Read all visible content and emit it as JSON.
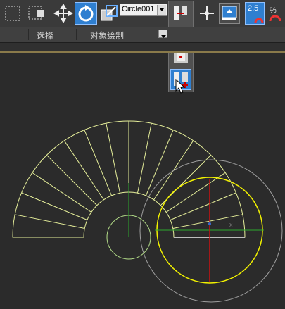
{
  "toolbar": {
    "object_dropdown_value": "Circle001",
    "snap_value": "2.5",
    "icons": [
      "selection-region-icon",
      "window-crossing-icon",
      "move-icon",
      "rotate-icon",
      "scale-icon",
      "use-pivot-icon",
      "snap-pivot-icon",
      "keyboard-shortcut-override-icon",
      "snaps-toggle-icon",
      "percent-snap-icon"
    ]
  },
  "ribbon": {
    "tab_select": "选择",
    "tab_object_paint": "对象绘制"
  },
  "colors": {
    "active_blue": "#2f7fd0",
    "wire_yellow_green": "#e6ef9a",
    "selected_circle": "#f2f200",
    "gizmo_green": "#2ea82e",
    "gizmo_red": "#cc1111",
    "gizmo_grey": "#a0a0a0"
  }
}
